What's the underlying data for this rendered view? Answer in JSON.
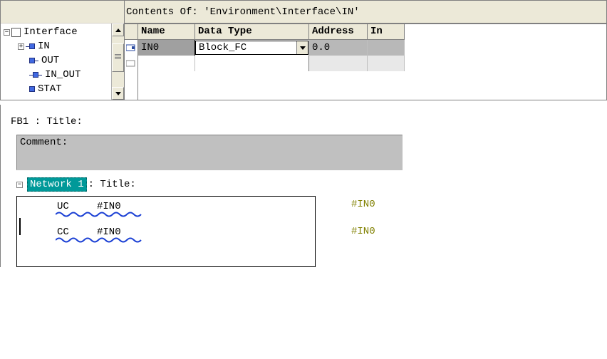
{
  "contents_title": "Contents Of: 'Environment\\Interface\\IN'",
  "tree": {
    "root": "Interface",
    "items": [
      "IN",
      "OUT",
      "IN_OUT",
      "STAT"
    ]
  },
  "grid": {
    "headers": [
      "Name",
      "Data Type",
      "Address",
      "In"
    ],
    "row": {
      "name": "IN0",
      "data_type": "Block_FC",
      "address": "0.0",
      "in": ""
    }
  },
  "block": {
    "label": "FB1 : Title:",
    "comment_label": "Comment:"
  },
  "network": {
    "label": "Network 1",
    "title_suffix": ": Title:"
  },
  "code": {
    "lines": [
      {
        "op": "UC",
        "arg": "#IN0"
      },
      {
        "op": "CC",
        "arg": "#IN0"
      }
    ]
  },
  "side_comments": [
    "#IN0",
    "#IN0"
  ],
  "icons": {
    "collapse": "−",
    "expand": "+"
  }
}
